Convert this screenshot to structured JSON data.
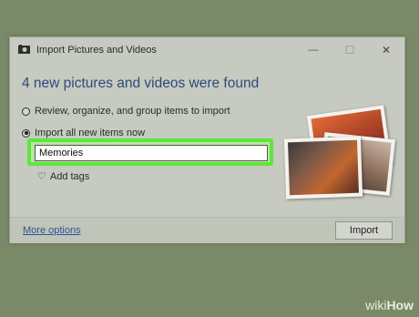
{
  "window": {
    "title": "Import Pictures and Videos",
    "minimize_glyph": "—",
    "maximize_glyph": "☐",
    "close_glyph": "✕"
  },
  "main": {
    "heading": "4 new pictures and videos were found",
    "option_review": "Review, organize, and group items to import",
    "option_import_all": "Import all new items now",
    "name_input_value": "Memories",
    "add_tags_label": "Add tags",
    "selected_option": "import_all"
  },
  "footer": {
    "more_options_label": "More options",
    "import_button_label": "Import"
  },
  "watermark": {
    "part1": "wiki",
    "part2": "How"
  },
  "colors": {
    "highlight": "#5fe63a",
    "link": "#2b5599",
    "heading": "#2d4b7a"
  }
}
